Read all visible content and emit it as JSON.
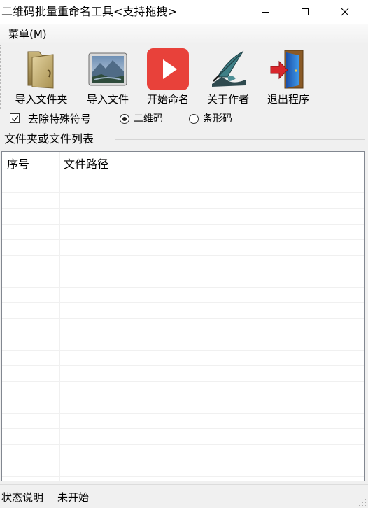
{
  "window": {
    "title": "二维码批量重命名工具<支持拖拽>",
    "controls": [
      "minimize",
      "maximize",
      "close"
    ]
  },
  "menubar": {
    "items": [
      {
        "label": "菜单(M)"
      }
    ]
  },
  "toolbar": {
    "buttons": [
      {
        "label": "导入文件夹",
        "icon": "folder-icon"
      },
      {
        "label": "导入文件",
        "icon": "image-file-icon"
      },
      {
        "label": "开始命名",
        "icon": "play-icon"
      },
      {
        "label": "关于作者",
        "icon": "quill-pen-icon"
      },
      {
        "label": "退出程序",
        "icon": "exit-door-icon"
      }
    ]
  },
  "options": {
    "remove_special_chars": {
      "label": "去除特殊符号",
      "checked": true
    },
    "code_type": {
      "options": [
        {
          "label": "二维码",
          "selected": true
        },
        {
          "label": "条形码",
          "selected": false
        }
      ]
    }
  },
  "file_list": {
    "group_title": "文件夹或文件列表",
    "columns": [
      "序号",
      "文件路径"
    ],
    "rows": []
  },
  "statusbar": {
    "label": "状态说明",
    "value": "未开始"
  },
  "colors": {
    "window_bg": "#f0f0f0",
    "list_bg": "#ffffff",
    "play_red": "#e8413a",
    "exit_red": "#d8262c",
    "door_blue": "#1f6fd1"
  }
}
